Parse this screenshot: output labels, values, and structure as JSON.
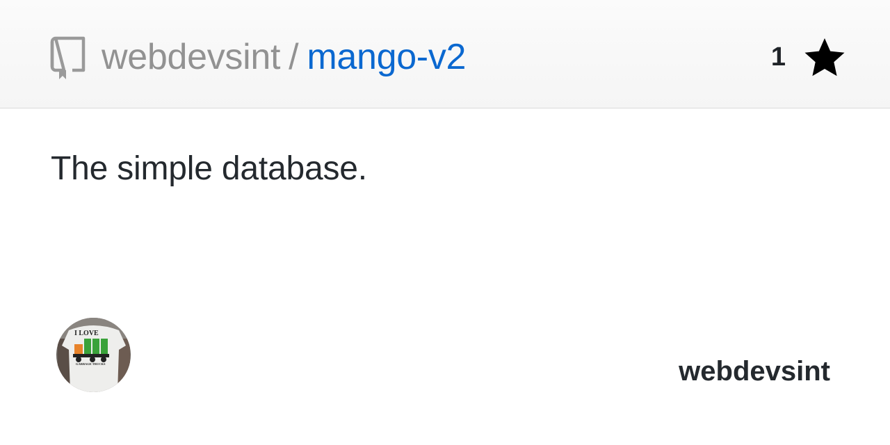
{
  "header": {
    "owner": "webdevsint",
    "separator": "/",
    "repo_name": "mango-v2",
    "star_count": "1",
    "icons": {
      "repo": "repo-icon",
      "star": "star-icon"
    }
  },
  "description": "The simple database.",
  "author": {
    "username": "webdevsint",
    "avatar_shirt_text_top": "I LOVE",
    "avatar_shirt_text_bottom": "GARBAGE TRUCKS"
  },
  "colors": {
    "owner_text": "#929292",
    "repo_link": "#0b68d0",
    "body_text": "#24292e",
    "header_bg": "#f7f7f7"
  }
}
